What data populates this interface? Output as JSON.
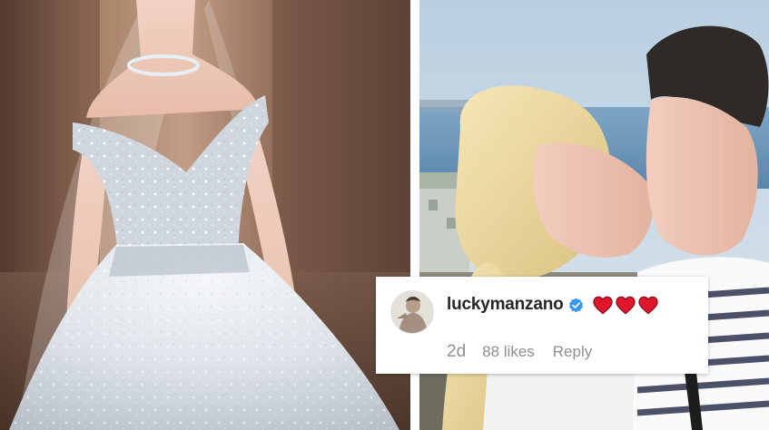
{
  "left_photo": {
    "description_icon": "bride-in-gown-photo"
  },
  "right_photo": {
    "description_icon": "couple-kissing-photo"
  },
  "comment": {
    "username": "luckymanzano",
    "verified_icon": "verified-badge-icon",
    "emoji_icon": "red-heart-icon",
    "emoji_count": 3,
    "time": "2d",
    "likes": "88 likes",
    "reply_label": "Reply",
    "colors": {
      "verified": "#3897f0",
      "heart": "#e0162b",
      "meta": "#8e8e8e",
      "username": "#262626"
    }
  }
}
